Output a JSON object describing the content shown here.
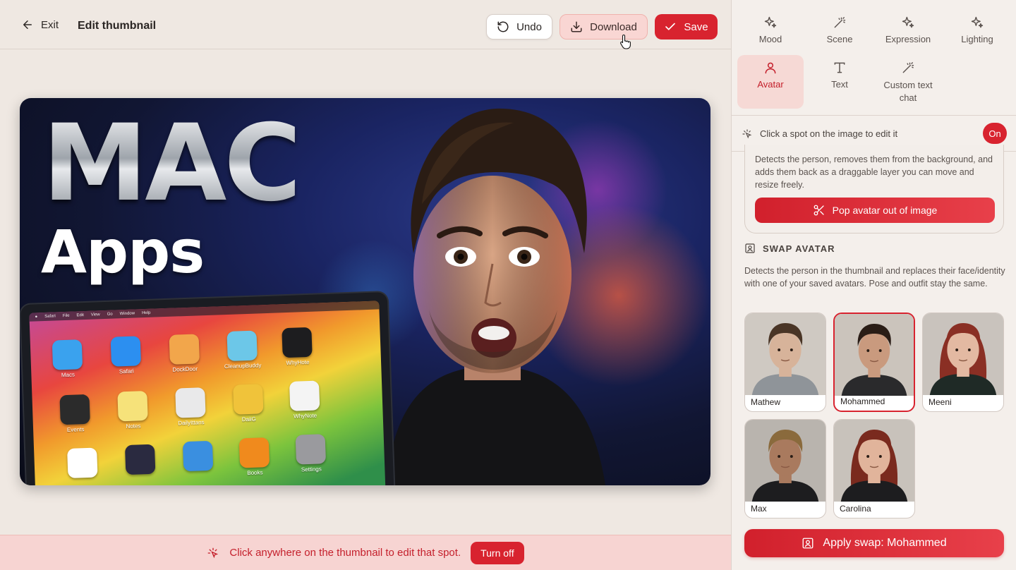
{
  "header": {
    "exit_label": "Exit",
    "title": "Edit thumbnail",
    "undo_label": "Undo",
    "download_label": "Download",
    "save_label": "Save"
  },
  "thumbnail": {
    "headline": "MAC",
    "subheadline": "Apps",
    "laptop_menu": [
      "Safari",
      "File",
      "Edit",
      "View",
      "Go",
      "Window",
      "Help"
    ],
    "desktop_apps": [
      {
        "label": "Macs",
        "icon": "finder-icon",
        "color": "#3aa2ee"
      },
      {
        "label": "Safari",
        "icon": "safari-icon",
        "color": "#2c8ff0"
      },
      {
        "label": "DockDoor",
        "icon": "dockdoor-icon",
        "color": "#f2a64b"
      },
      {
        "label": "CleanupBuddy",
        "icon": "cleanupbuddy-icon",
        "color": "#6cc7e8"
      },
      {
        "label": "WhyHote",
        "icon": "whyhote-icon",
        "color": "#1d1d1f"
      },
      {
        "label": "Events",
        "icon": "calculator-icon",
        "color": "#2b2b2b"
      },
      {
        "label": "Notes",
        "icon": "notes-icon",
        "color": "#f6e27a"
      },
      {
        "label": "DailyIttans",
        "icon": "play-icon",
        "color": "#e9e9ea"
      },
      {
        "label": "DaiiG",
        "icon": "daiig-icon",
        "color": "#f0c33a"
      },
      {
        "label": "WhyNote",
        "icon": "whynote-icon",
        "color": "#f4f4f4"
      },
      {
        "label": "",
        "icon": "chart-icon",
        "color": "#ffffff"
      },
      {
        "label": "",
        "icon": "siri-icon",
        "color": "#2a2a40"
      },
      {
        "label": "",
        "icon": "keynote-icon",
        "color": "#3a8fe0"
      },
      {
        "label": "Books",
        "icon": "books-icon",
        "color": "#f08a1d"
      },
      {
        "label": "Settings",
        "icon": "settings-icon",
        "color": "#9a9a9e"
      }
    ]
  },
  "bottom_bar": {
    "message": "Click anywhere on the thumbnail to edit that spot.",
    "turn_off_label": "Turn off"
  },
  "tools": [
    {
      "label": "Mood",
      "icon": "sparkles-icon"
    },
    {
      "label": "Scene",
      "icon": "magic-wand-icon"
    },
    {
      "label": "Expression",
      "icon": "sparkles-icon"
    },
    {
      "label": "Lighting",
      "icon": "sparkles-icon"
    },
    {
      "label": "Avatar",
      "icon": "person-icon",
      "active": true
    },
    {
      "label": "Text",
      "icon": "text-icon"
    },
    {
      "label": "Custom text chat",
      "icon": "magic-wand-icon"
    }
  ],
  "click_spot": {
    "label": "Click a spot on the image to edit it",
    "toggle_label": "On"
  },
  "pop_avatar": {
    "description": "Detects the person, removes them from the background, and adds them back as a draggable layer you can move and resize freely.",
    "button_label": "Pop avatar out of image"
  },
  "swap_avatar": {
    "heading": "SWAP AVATAR",
    "description": "Detects the person in the thumbnail and replaces their face/identity with one of your saved avatars. Pose and outfit stay the same.",
    "avatars": [
      {
        "name": "Mathew",
        "selected": false,
        "hair": "#4a3526",
        "skin": "#d7b39a",
        "shirt": "#8f9499",
        "bg": "#cfc9c2"
      },
      {
        "name": "Mohammed",
        "selected": true,
        "hair": "#2a1d16",
        "skin": "#c99a7e",
        "shirt": "#2a2a2c",
        "bg": "#cbc4bc"
      },
      {
        "name": "Meeni",
        "selected": false,
        "hair": "#8a2f24",
        "skin": "#e3b9a2",
        "shirt": "#1f2a26",
        "bg": "#c9c3bd"
      },
      {
        "name": "Max",
        "selected": false,
        "hair": "#8a6a3c",
        "skin": "#a97a5e",
        "shirt": "#1d1d1f",
        "bg": "#b9b4ae"
      },
      {
        "name": "Carolina",
        "selected": false,
        "hair": "#7a2a1e",
        "skin": "#e1b49b",
        "shirt": "#1d1d1f",
        "bg": "#c8c2bb"
      }
    ],
    "apply_label": "Apply swap: Mohammed"
  }
}
